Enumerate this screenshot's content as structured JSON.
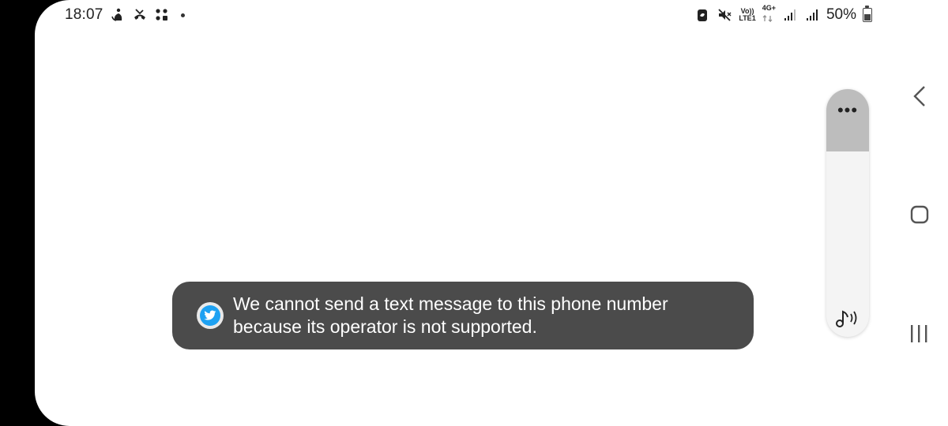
{
  "status_bar": {
    "time": "18:07",
    "left_icons": [
      "hotspot-icon",
      "missed-call-icon",
      "app-grid-icon",
      "notification-dot"
    ],
    "right_icons": [
      "battery-saver-icon",
      "mute-icon",
      "volte-icon",
      "4g-icon",
      "signal-sim1-icon",
      "signal-sim2-icon"
    ],
    "volte_label_top": "Vo))",
    "volte_label_bottom": "LTE1",
    "network_label": "4G+",
    "battery_percent": "50%",
    "battery_level": 0.5
  },
  "volume_panel": {
    "more_label": "•••",
    "volume_level": 0.25,
    "stream_icon": "music-note-sound-icon"
  },
  "nav_bar": {
    "buttons": [
      "back-icon",
      "home-icon",
      "recents-icon"
    ]
  },
  "toast": {
    "icon": "twitter-icon",
    "line1": "We cannot send a text message to this phone number",
    "line2": "because its operator is not supported.",
    "accent_color": "#1da1f2",
    "background_color": "#4b4b4b"
  }
}
